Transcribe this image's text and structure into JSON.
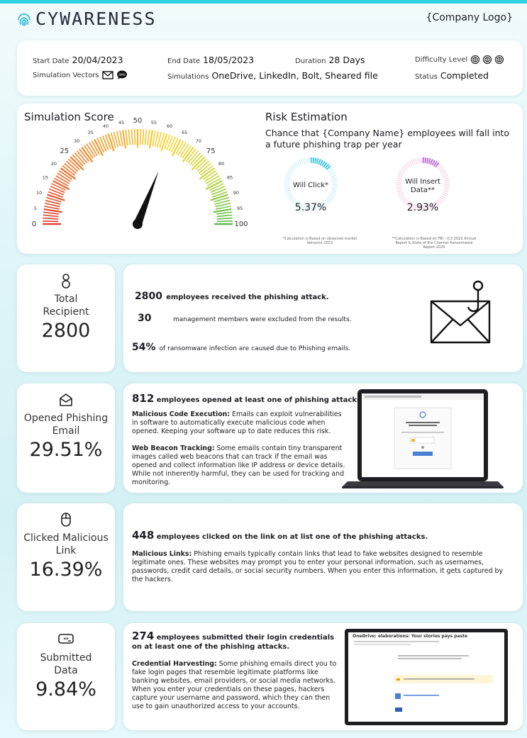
{
  "brand": {
    "name": "CYWARENESS",
    "company_logo": "{Company Logo}"
  },
  "info": {
    "start_date_label": "Start Date",
    "start_date": "20/04/2023",
    "end_date_label": "End Date",
    "end_date": "18/05/2023",
    "duration_label": "Duration",
    "duration": "28 Days",
    "difficulty_label": "Difficulty Level",
    "vectors_label": "Simulation Vectors",
    "simulations_label": "Simulations",
    "simulations": "OneDrive, LinkedIn, Bolt, Sheared file",
    "status_label": "Status",
    "status": "Completed"
  },
  "score": {
    "title": "Simulation Score",
    "gauge_ticks": [
      "0",
      "5",
      "10",
      "15",
      "20",
      "25",
      "30",
      "35",
      "40",
      "45",
      "50",
      "55",
      "60",
      "65",
      "70",
      "75",
      "80",
      "85",
      "90",
      "95",
      "100"
    ],
    "value": 62
  },
  "risk": {
    "title": "Risk Estimation",
    "subtitle": "Chance that {Company Name} employees will fall into a future phishing trap per year",
    "click_label": "Will Click*",
    "click_value": "5.37%",
    "insert_label": "Will Insert Data**",
    "insert_value": "2.93%",
    "click_note": "*Calculation is Based on observed market behavior 2022",
    "insert_note": "**Calculation is Based on FBI - IC3 2022 Annual Report & State of the Channel Ransomware Report 2020"
  },
  "recipients": {
    "icon": "person-icon",
    "label": "Total Recipient",
    "value": "2800",
    "line1_num": "2800",
    "line1_text": "employees received the phishing attack.",
    "line2_num": "30",
    "line2_text": "management members were excluded from the results.",
    "line3_num": "54%",
    "line3_text": "of ransomware infection are caused due to Phishing emails."
  },
  "opened": {
    "icon": "open-envelope-icon",
    "label": "Opened Phishing Email",
    "value": "29.51%",
    "head_num": "812",
    "head_text": "employees opened at least one of phishing attacks.",
    "p1_title": "Malicious Code Execution:",
    "p1_text": "Emails can exploit vulnerabilities in software to automatically execute malicious code when opened. Keeping your software up to date reduces this risk.",
    "p2_title": "Web Beacon Tracking:",
    "p2_text": "Some emails contain tiny transparent images called web beacons that can track if the email was opened and collect information like IP address or device details. While not inherently harmful, they can be used for tracking and monitoring."
  },
  "clicked": {
    "icon": "mouse-icon",
    "label": "Clicked Malicious Link",
    "value": "16.39%",
    "head_num": "448",
    "head_text": "employees  clicked on the link on at list one of the phishing attacks.",
    "p1_title": "Malicious Links:",
    "p1_text": "Phishing emails typically contain links that lead to fake websites designed to resemble legitimate ones. These websites may prompt you to enter your personal information, such as usernames, passwords, credit card details, or social security numbers. When you enter this information, it gets captured by the hackers."
  },
  "submitted": {
    "icon": "password-field-icon",
    "label": "Submitted Data",
    "value": "9.84%",
    "head_num": "274",
    "head_text": "employees submitted their login credentials on at least one of the phishing attacks.",
    "p1_title": "Credential Harvesting:",
    "p1_text": "Some phishing emails direct you to fake login pages that resemble legitimate platforms like banking websites, email providers, or social media networks. When you enter your credentials on these pages, hackers capture your username and password, which they can then use to gain unauthorized access to your accounts.",
    "screen_title": "OneDrive: elaborations: Your stories pays paste"
  }
}
